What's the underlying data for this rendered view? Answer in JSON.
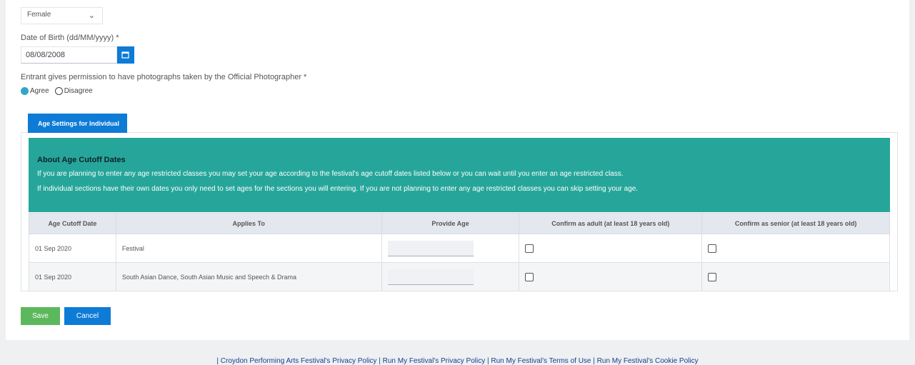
{
  "form": {
    "gender_value": "Female",
    "dob_label": "Date of Birth (dd/MM/yyyy)",
    "required_mark": "*",
    "dob_value": "08/08/2008",
    "photo_label": "Entrant gives permission to have photographs taken by the Official Photographer",
    "agree_label": "Agree",
    "disagree_label": "Disagree",
    "photo_selected": "Agree"
  },
  "age_settings": {
    "tab_label": "Age Settings for Individual",
    "info_title": "About Age Cutoff Dates",
    "info_line1": "If you are planning to enter any age restricted classes you may set your age according to the festival's age cutoff dates listed below or you can wait until you enter an age restricted class.",
    "info_line2": "If individual sections have their own dates you only need to set ages for the sections you will entering. If you are not planning to enter any age restricted classes you can skip setting your age.",
    "columns": [
      "Age Cutoff Date",
      "Applies To",
      "Provide Age",
      "Confirm as adult (at least 18 years old)",
      "Confirm as senior (at least 18 years old)"
    ],
    "rows": [
      {
        "date": "01 Sep 2020",
        "applies_to": "Festival",
        "age": "",
        "adult": false,
        "senior": false
      },
      {
        "date": "01 Sep 2020",
        "applies_to": "South Asian Dance, South Asian Music and Speech & Drama",
        "age": "",
        "adult": false,
        "senior": false
      }
    ]
  },
  "actions": {
    "save_label": "Save",
    "cancel_label": "Cancel"
  },
  "footer": {
    "sep": "|",
    "links": [
      "Croydon Performing Arts Festival's Privacy Policy",
      "Run My Festival's Privacy Policy",
      "Run My Festival's Terms of Use",
      "Run My Festival's Cookie Policy"
    ]
  },
  "colors": {
    "primary": "#0e7bd6",
    "teal": "#26a69a",
    "save_green": "#5cb85c"
  }
}
